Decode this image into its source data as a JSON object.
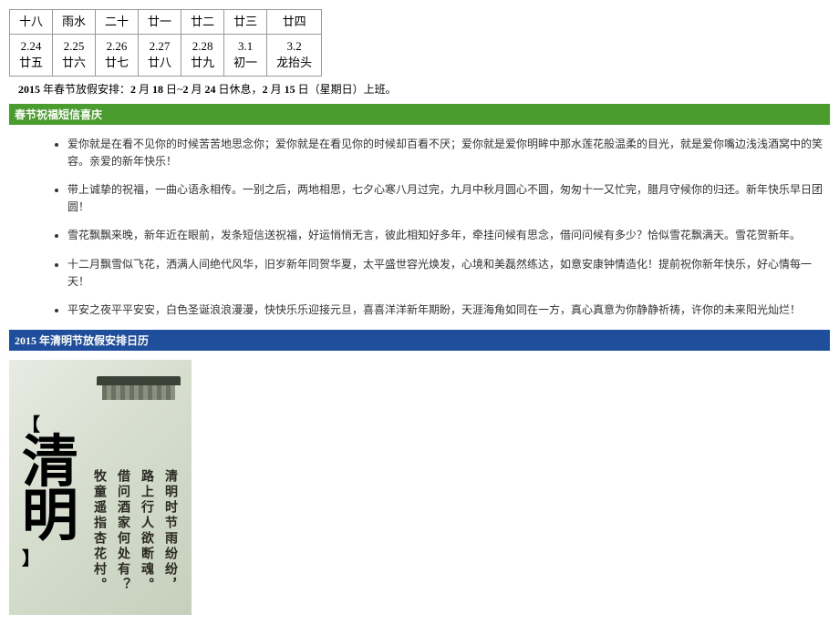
{
  "calendar": {
    "row1": [
      "十八",
      "雨水",
      "二十",
      "廿一",
      "廿二",
      "廿三",
      "廿四"
    ],
    "row2_top": [
      "2.24",
      "2.25",
      "2.26",
      "2.27",
      "2.28",
      "3.1",
      "3.2"
    ],
    "row2_bot": [
      "廿五",
      "廿六",
      "廿七",
      "廿八",
      "廿九",
      "初一",
      "龙抬头"
    ]
  },
  "schedule_note": {
    "prefix_bold": "2015",
    "text1": " 年春节放假安排：",
    "bold2": "2",
    "text2": " 月 ",
    "bold3": "18",
    "text3": " 日~",
    "bold4": "2",
    "text4": " 月 ",
    "bold5": "24",
    "text5": " 日休息，",
    "bold6": "2",
    "text6": " 月 ",
    "bold7": "15",
    "text7": " 日（星期日）上班。"
  },
  "section1_title": "春节祝福短信喜庆",
  "messages": [
    "爱你就是在看不见你的时候苦苦地思念你；爱你就是在看见你的时候却百看不厌；爱你就是爱你明眸中那水莲花般温柔的目光，就是爱你嘴边浅浅酒窝中的笑容。亲爱的新年快乐！",
    "带上诚挚的祝福，一曲心语永相传。一别之后，两地相思，七夕心寒八月过完，九月中秋月圆心不圆，匆匆十一又忙完，腊月守候你的归还。新年快乐早日团圆！",
    "雪花飘飘来晚，新年近在眼前，发条短信送祝福，好运悄悄无言，彼此相知好多年，牵挂问候有思念，借问问候有多少？恰似雪花飘满天。雪花贺新年。",
    "十二月飘雪似飞花，洒满人间绝代风华，旧岁新年同贺华夏，太平盛世容光焕发，心境和美磊然练达，如意安康钟情造化！提前祝你新年快乐，好心情每一天！",
    "平安之夜平平安安，白色圣诞浪浪漫漫，快快乐乐迎接元旦，喜喜洋洋新年期盼，天涯海角如同在一方，真心真意为你静静祈祷，许你的未来阳光灿烂！"
  ],
  "section2_title": "2015 年清明节放假安排日历",
  "qingming": {
    "bracket_top": "【",
    "char1": "清",
    "char2": "明",
    "bracket_bot": "】",
    "poem": [
      "清明时节雨纷纷，",
      "路上行人欲断魂。",
      "借问酒家何处有？",
      "牧童遥指杏花村。"
    ]
  }
}
